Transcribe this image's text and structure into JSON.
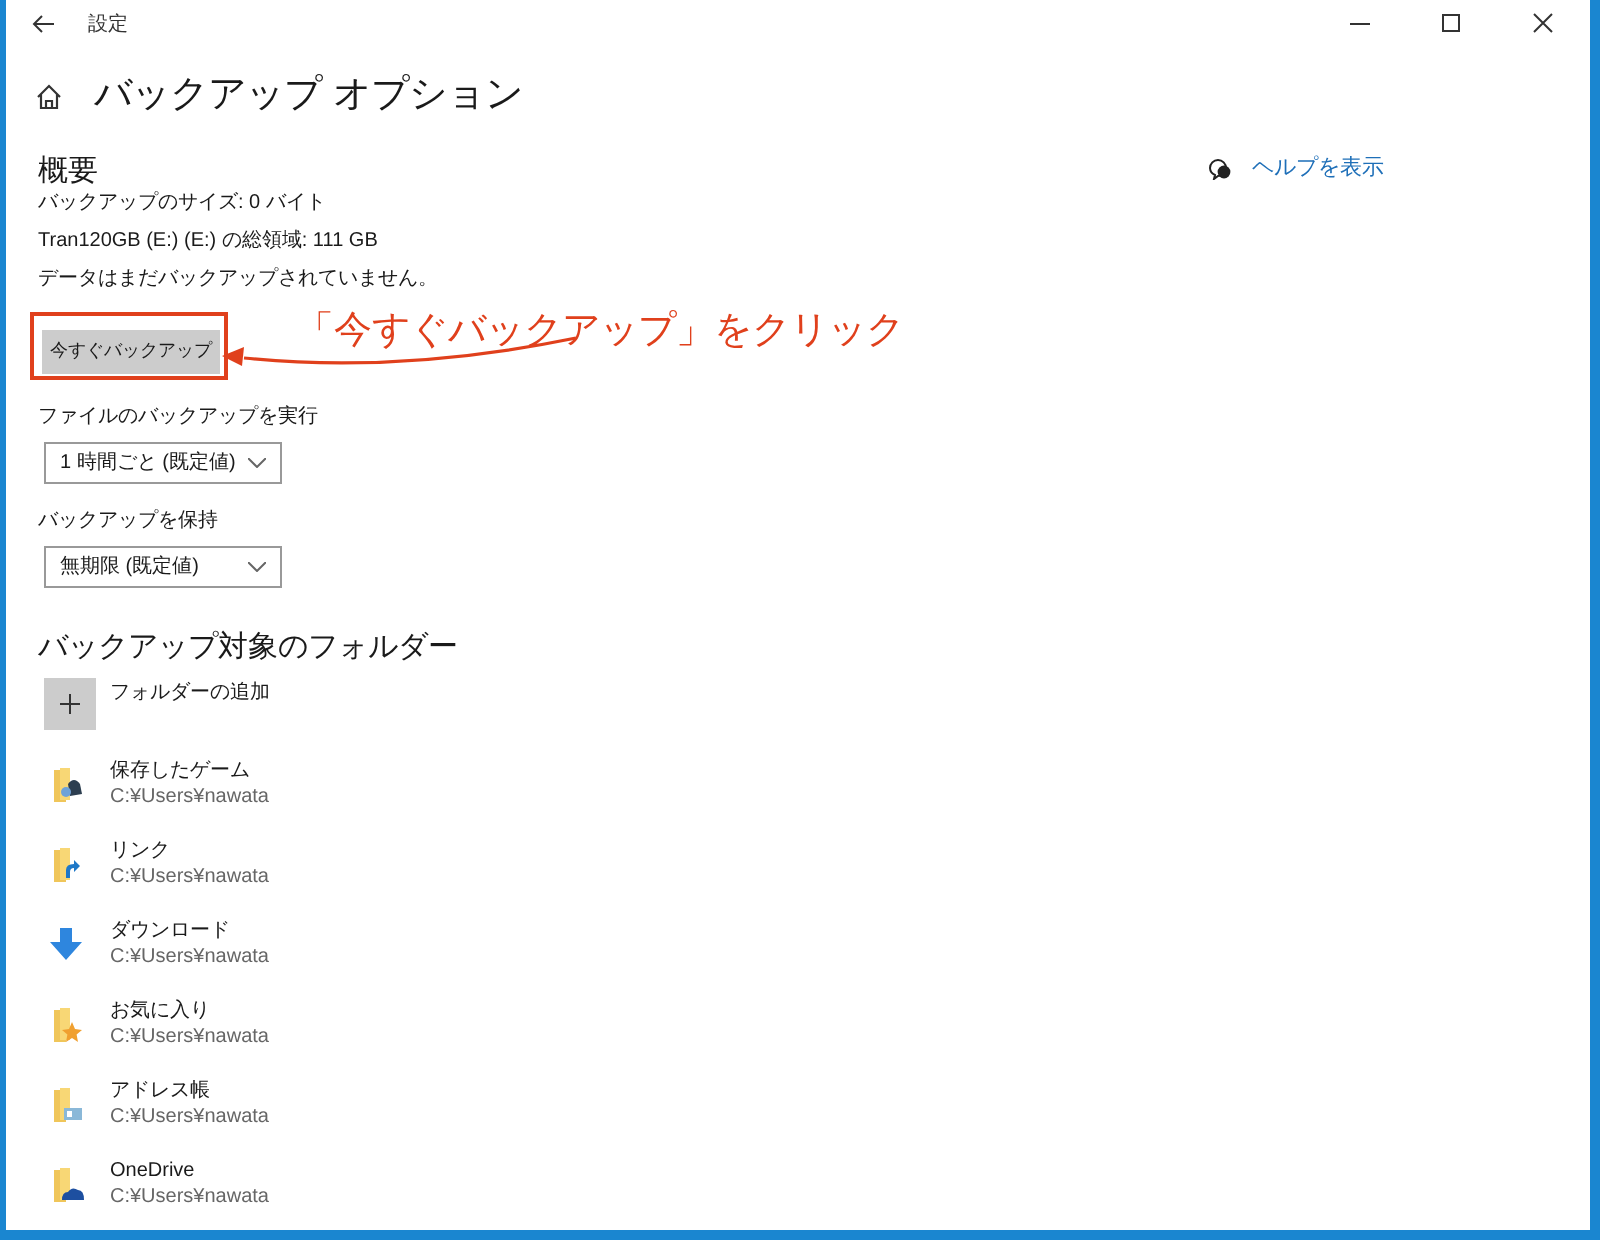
{
  "window": {
    "title": "設定"
  },
  "page_title": "バックアップ オプション",
  "help_link": "ヘルプを表示",
  "overview": {
    "heading": "概要",
    "lines": [
      "バックアップのサイズ: 0 バイト",
      "Tran120GB (E:) (E:) の総領域: 111 GB",
      "データはまだバックアップされていません。"
    ],
    "button": "今すぐバックアップ"
  },
  "annotation": {
    "text": "「今すぐバックアップ」をクリック"
  },
  "dropdowns": [
    {
      "label": "ファイルのバックアップを実行",
      "value": "1 時間ごと (既定値)"
    },
    {
      "label": "バックアップを保持",
      "value": "無期限 (既定値)"
    }
  ],
  "folders": {
    "heading": "バックアップ対象のフォルダー",
    "add_label": "フォルダーの追加",
    "items": [
      {
        "kind": "game",
        "name": "保存したゲーム",
        "path": "C:¥Users¥nawata"
      },
      {
        "kind": "link",
        "name": "リンク",
        "path": "C:¥Users¥nawata"
      },
      {
        "kind": "download",
        "name": "ダウンロード",
        "path": "C:¥Users¥nawata"
      },
      {
        "kind": "favorites",
        "name": "お気に入り",
        "path": "C:¥Users¥nawata"
      },
      {
        "kind": "contacts",
        "name": "アドレス帳",
        "path": "C:¥Users¥nawata"
      },
      {
        "kind": "onedrive",
        "name": "OneDrive",
        "path": "C:¥Users¥nawata"
      }
    ]
  }
}
